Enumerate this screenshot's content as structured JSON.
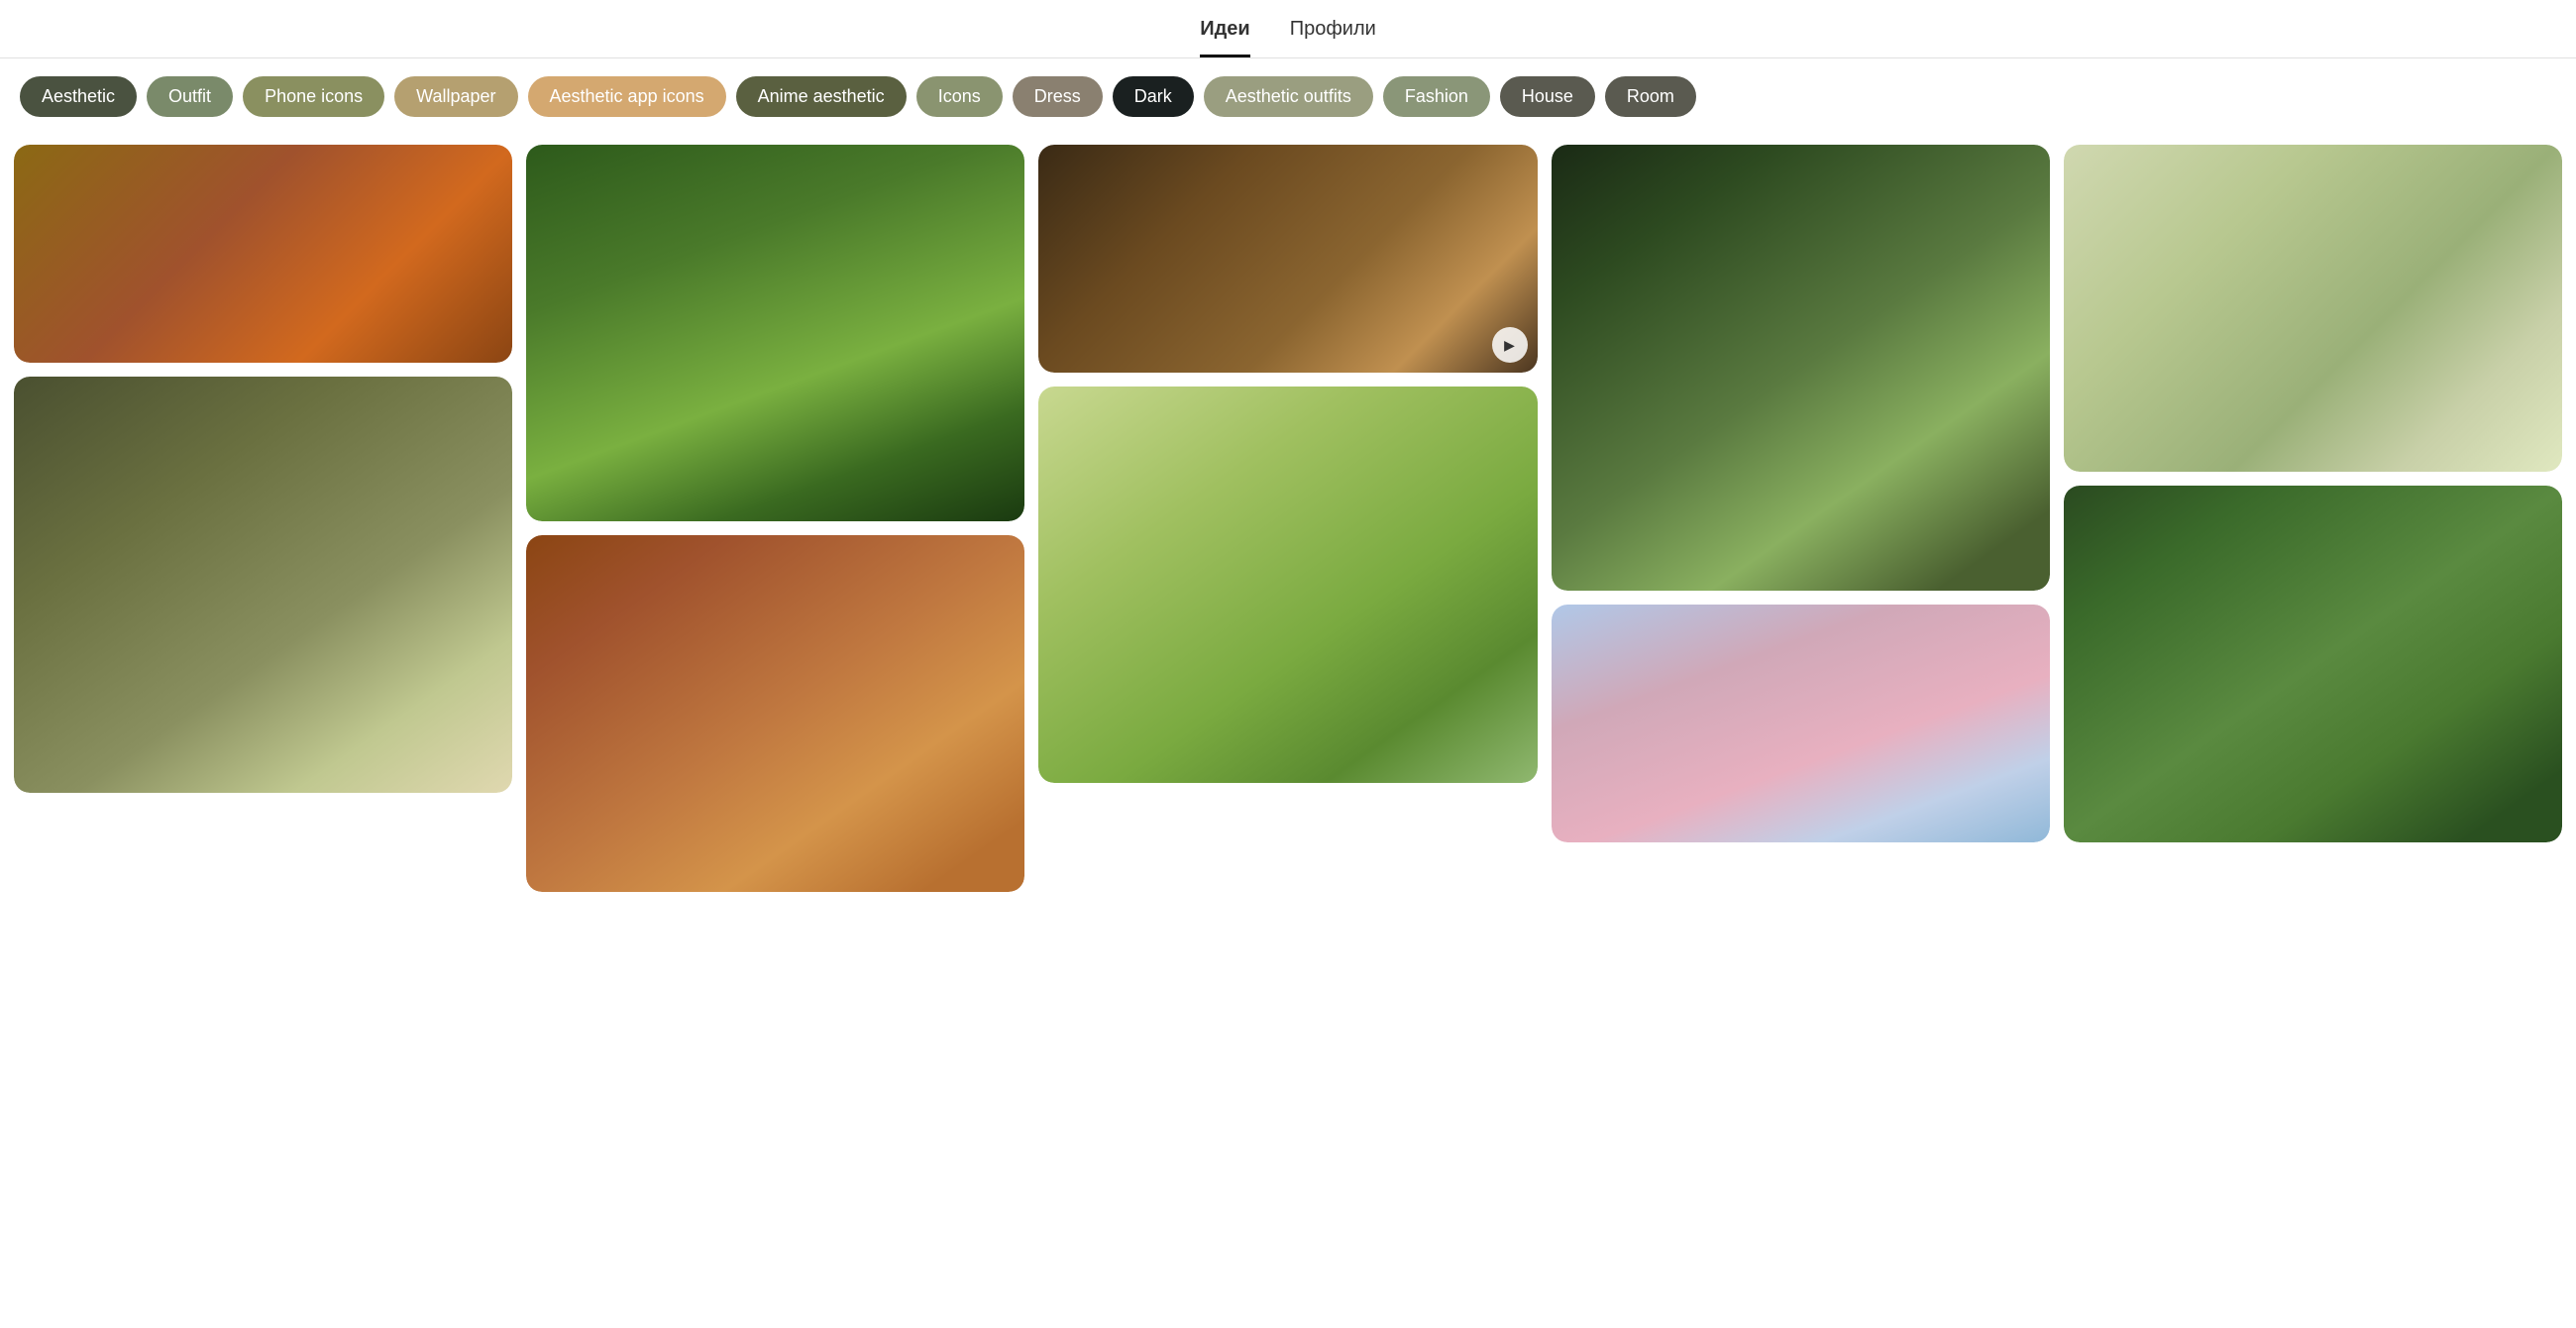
{
  "tabs": [
    {
      "id": "ideas",
      "label": "Идеи",
      "active": true
    },
    {
      "id": "profiles",
      "label": "Профили",
      "active": false
    }
  ],
  "chips": [
    {
      "id": "aesthetic",
      "label": "Aesthetic",
      "style": "chip-dark-green"
    },
    {
      "id": "outfit",
      "label": "Outfit",
      "style": "chip-medium-green"
    },
    {
      "id": "phone-icons",
      "label": "Phone icons",
      "style": "chip-olive"
    },
    {
      "id": "wallpaper",
      "label": "Wallpaper",
      "style": "chip-tan"
    },
    {
      "id": "aesthetic-app-icons",
      "label": "Aesthetic app icons",
      "style": "chip-peach"
    },
    {
      "id": "anime-aesthetic",
      "label": "Anime aesthetic",
      "style": "chip-dark-olive"
    },
    {
      "id": "icons",
      "label": "Icons",
      "style": "chip-muted-green"
    },
    {
      "id": "dress",
      "label": "Dress",
      "style": "chip-taupe"
    },
    {
      "id": "dark",
      "label": "Dark",
      "style": "chip-dark"
    },
    {
      "id": "aesthetic-outfits",
      "label": "Aesthetic outfits",
      "style": "chip-light-olive"
    },
    {
      "id": "fashion",
      "label": "Fashion",
      "style": "chip-sage"
    },
    {
      "id": "house",
      "label": "House",
      "style": "chip-dark-gray"
    },
    {
      "id": "room",
      "label": "Room",
      "style": "chip-dark-gray"
    }
  ],
  "pins": [
    {
      "id": 1,
      "imgClass": "img-kitchen",
      "hasPlay": false,
      "col": 1
    },
    {
      "id": 2,
      "imgClass": "img-forest",
      "hasPlay": false,
      "col": 2
    },
    {
      "id": 3,
      "imgClass": "img-candles",
      "hasPlay": true,
      "col": 3
    },
    {
      "id": 4,
      "imgClass": "img-boho-room",
      "hasPlay": false,
      "col": 4
    },
    {
      "id": 5,
      "imgClass": "img-bright-room",
      "hasPlay": false,
      "col": 5
    },
    {
      "id": 6,
      "imgClass": "img-cat",
      "hasPlay": false,
      "col": 1
    },
    {
      "id": 7,
      "imgClass": "img-picnic",
      "hasPlay": false,
      "col": 2
    },
    {
      "id": 8,
      "imgClass": "img-window",
      "hasPlay": false,
      "col": 3
    },
    {
      "id": 9,
      "imgClass": "img-sky",
      "hasPlay": false,
      "col": 4
    },
    {
      "id": 10,
      "imgClass": "img-cottage",
      "hasPlay": false,
      "col": 5
    }
  ],
  "play_icon": "▶"
}
